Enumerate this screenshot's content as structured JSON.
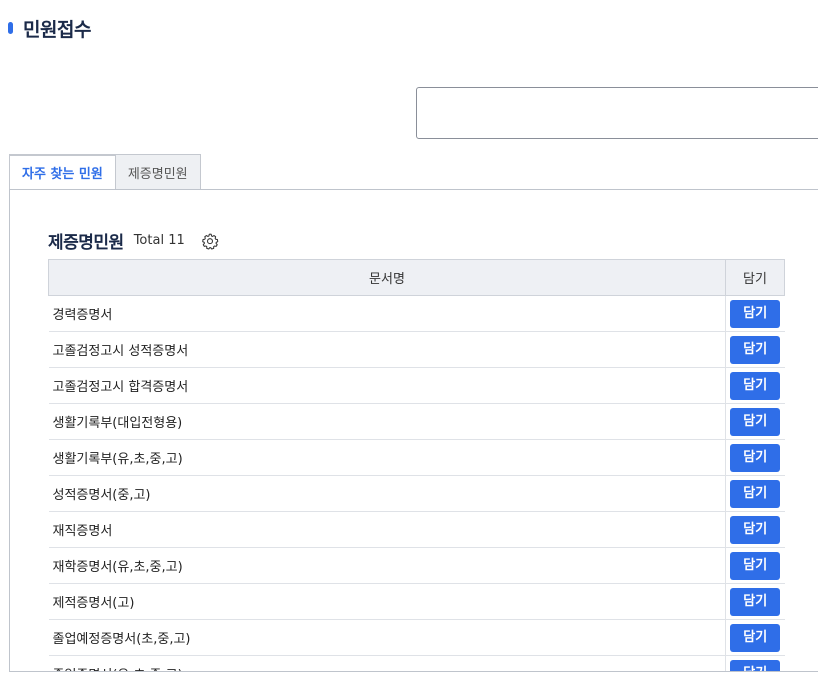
{
  "page": {
    "title": "민원접수"
  },
  "search": {
    "value": ""
  },
  "tabs": [
    {
      "label": "자주 찾는 민원",
      "active": true
    },
    {
      "label": "제증명민원",
      "active": false
    }
  ],
  "section": {
    "title": "제증명민원",
    "total": "Total 11",
    "settings_icon": "gear-icon"
  },
  "table": {
    "headers": {
      "name": "문서명",
      "add": "담기"
    },
    "rows": [
      {
        "name": "경력증명서",
        "button": "담기"
      },
      {
        "name": "고졸검정고시 성적증명서",
        "button": "담기"
      },
      {
        "name": "고졸검정고시 합격증명서",
        "button": "담기"
      },
      {
        "name": "생활기록부(대입전형용)",
        "button": "담기"
      },
      {
        "name": "생활기록부(유,초,중,고)",
        "button": "담기"
      },
      {
        "name": "성적증명서(중,고)",
        "button": "담기"
      },
      {
        "name": "재직증명서",
        "button": "담기"
      },
      {
        "name": "재학증명서(유,초,중,고)",
        "button": "담기"
      },
      {
        "name": "제적증명서(고)",
        "button": "담기"
      },
      {
        "name": "졸업예정증명서(초,중,고)",
        "button": "담기"
      },
      {
        "name": "졸업증명서(유,초,중,고)",
        "button": "담기"
      }
    ]
  },
  "colors": {
    "accent": "#2f6ee8",
    "title": "#1b2a49",
    "header_bg": "#eef0f4"
  }
}
